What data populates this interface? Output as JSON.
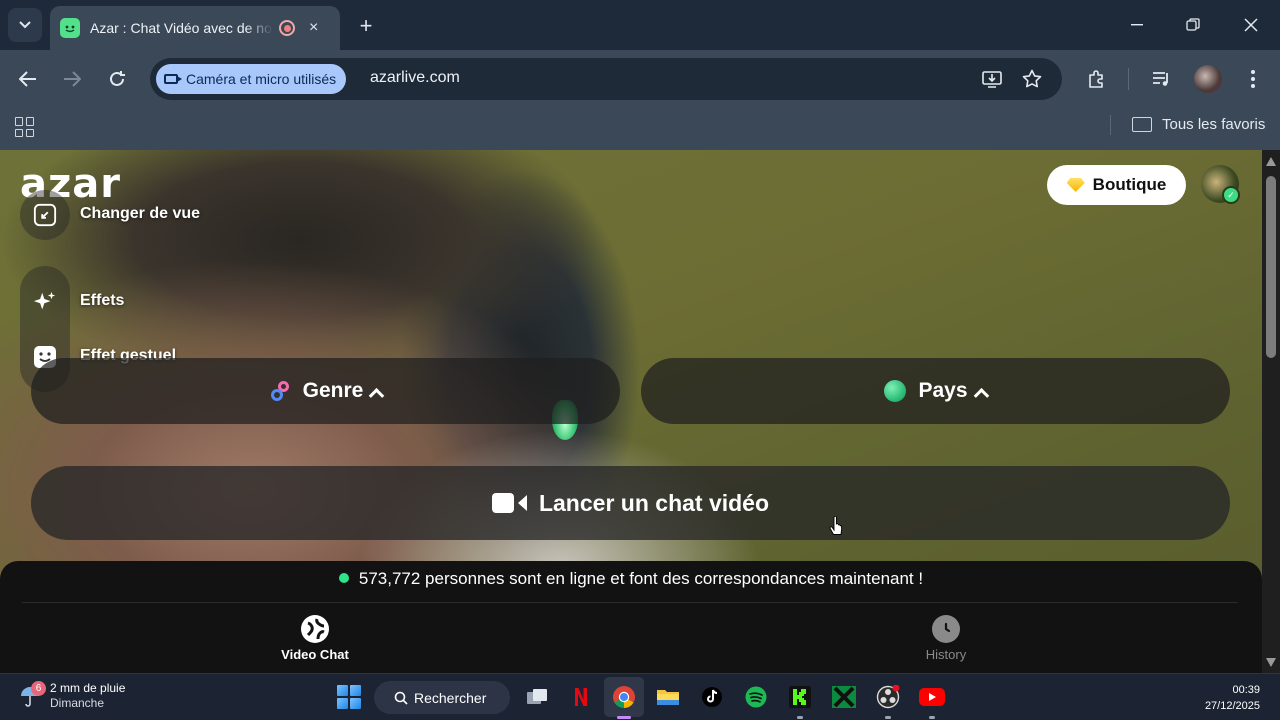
{
  "browser": {
    "tab_title": "Azar : Chat Vidéo avec de nouvelles personnes",
    "close_tab": "×",
    "new_tab": "+",
    "permission_chip": "Caméra et micro utilisés",
    "url": "azarlive.com",
    "bookmarks_label": "Tous les favoris"
  },
  "page": {
    "logo": "azar",
    "boutique_label": "Boutique",
    "side_menu": [
      {
        "label": "Changer de vue",
        "icon": "change-view-icon"
      },
      {
        "label": "Effets",
        "icon": "sparkle-icon"
      },
      {
        "label": "Effet gestuel",
        "icon": "smiley-icon"
      }
    ],
    "genre_label": "Genre",
    "pays_label": "Pays",
    "launch_label": "Lancer un chat vidéo",
    "online_text": "573,772 personnes sont en ligne et font des correspondances maintenant !",
    "bottom_nav": [
      {
        "label": "Video Chat",
        "icon": "globe-icon",
        "active": true
      },
      {
        "label": "History",
        "icon": "clock-icon",
        "active": false
      }
    ]
  },
  "taskbar": {
    "weather_badge": "6",
    "weather_title": "2 mm de pluie",
    "weather_sub": "Dimanche",
    "search_label": "Rechercher",
    "time": "00:39",
    "date": "27/12/2025"
  },
  "colors": {
    "chrome_dark": "#1e2a3a",
    "chrome_toolbar": "#3a4858",
    "chip": "#a8c7fa",
    "online_dot": "#2ee58a",
    "panel": "#121212"
  }
}
